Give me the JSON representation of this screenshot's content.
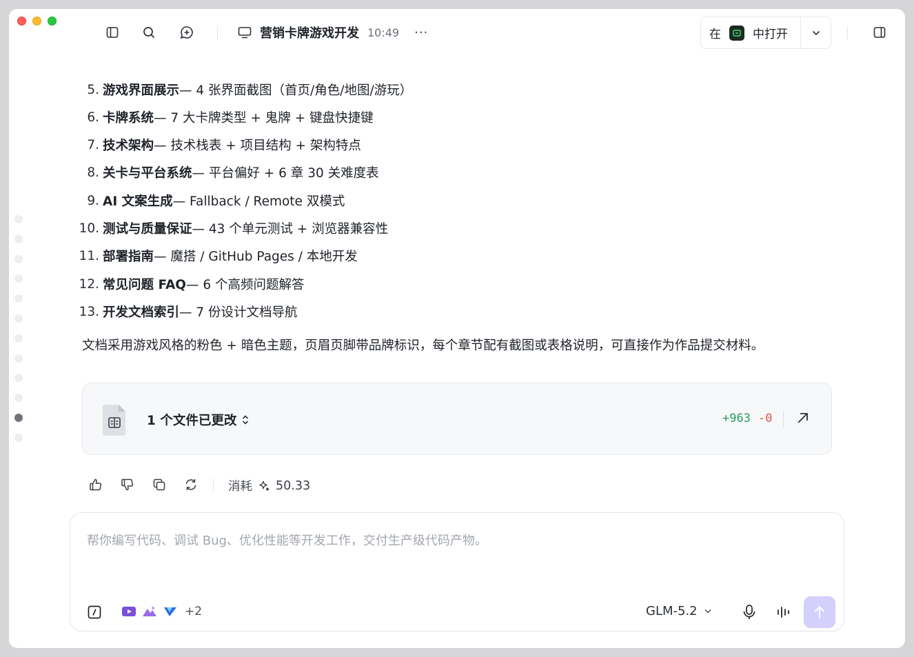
{
  "titlebar": {
    "title": "营销卡牌游戏开发",
    "time": "10:49",
    "more": "···",
    "open_prefix": "在",
    "open_suffix": "中打开"
  },
  "list": [
    {
      "num": "5.",
      "bold": "游戏界面展示",
      "rest": " — 4 张界面截图（首页/角色/地图/游玩）"
    },
    {
      "num": "6.",
      "bold": "卡牌系统",
      "rest": " — 7 大卡牌类型 + 鬼牌 + 键盘快捷键"
    },
    {
      "num": "7.",
      "bold": "技术架构",
      "rest": " — 技术栈表 + 项目结构 + 架构特点"
    },
    {
      "num": "8.",
      "bold": "关卡与平台系统",
      "rest": " — 平台偏好 + 6 章 30 关难度表"
    },
    {
      "num": "9.",
      "bold": "AI 文案生成",
      "rest": " — Fallback / Remote 双模式"
    },
    {
      "num": "10.",
      "bold": "测试与质量保证",
      "rest": " — 43 个单元测试 + 浏览器兼容性"
    },
    {
      "num": "11.",
      "bold": "部署指南",
      "rest": " — 魔搭 / GitHub Pages / 本地开发"
    },
    {
      "num": "12.",
      "bold": "常见问题 FAQ",
      "rest": " — 6 个高频问题解答"
    },
    {
      "num": "13.",
      "bold": "开发文档索引",
      "rest": " — 7 份设计文档导航"
    }
  ],
  "summary": "文档采用游戏风格的粉色 + 暗色主题，页眉页脚带品牌标识，每个章节配有截图或表格说明，可直接作为作品提交材料。",
  "file_card": {
    "label": "1 个文件已更改",
    "additions": "+963",
    "deletions": "-0"
  },
  "actions": {
    "cost_label": "消耗",
    "cost_value": "50.33"
  },
  "input": {
    "placeholder": "帮你编写代码、调试 Bug、优化性能等开发工作，交付生产级代码产物。",
    "tools_more": "+2",
    "model": "GLM-5.2"
  }
}
